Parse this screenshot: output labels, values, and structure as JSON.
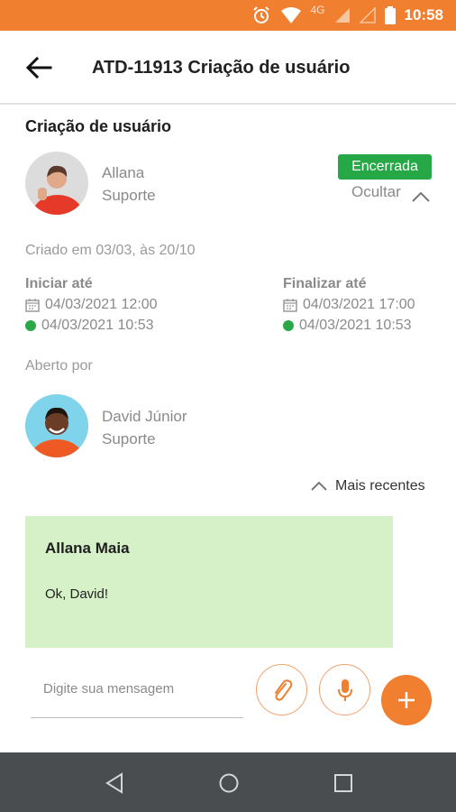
{
  "status_bar": {
    "time": "10:58",
    "network": "4G"
  },
  "app_bar": {
    "title": "ATD-11913  Criação de usuário"
  },
  "ticket": {
    "title": "Criação de usuário",
    "assignee": {
      "name": "Allana",
      "role": "Suporte"
    },
    "status": "Encerrada",
    "toggle_label": "Ocultar",
    "created": "Criado em 03/03, às 20/10",
    "start": {
      "label": "Iniciar até",
      "planned": "04/03/2021 12:00",
      "actual": "04/03/2021 10:53"
    },
    "finish": {
      "label": "Finalizar até",
      "planned": "04/03/2021 17:00",
      "actual": "04/03/2021 10:53"
    },
    "opened_by_label": "Aberto por",
    "opener": {
      "name": "David Júnior",
      "role": "Suporte"
    }
  },
  "sort": {
    "label": "Mais recentes"
  },
  "message": {
    "author": "Allana  Maia",
    "body": "Ok, David!"
  },
  "composer": {
    "placeholder": "Digite sua mensagem"
  },
  "colors": {
    "accent": "#f07f2f",
    "status": "#25a845",
    "message_bg": "#d6f1c7",
    "navbar": "#4a4d50"
  }
}
